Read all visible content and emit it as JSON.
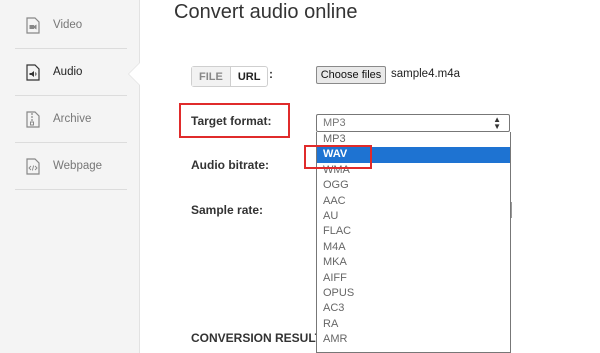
{
  "sidebar": {
    "items": [
      {
        "label": "Video",
        "icon": "video-file-icon"
      },
      {
        "label": "Audio",
        "icon": "audio-file-icon",
        "active": true
      },
      {
        "label": "Archive",
        "icon": "archive-file-icon"
      },
      {
        "label": "Webpage",
        "icon": "code-file-icon"
      }
    ]
  },
  "main": {
    "title": "Convert audio online",
    "source_toggle": {
      "file_label": "FILE",
      "url_label": "URL",
      "separator": ":"
    },
    "choose_files_label": "Choose files",
    "selected_file": "sample4.m4a",
    "target_format_label": "Target format:",
    "audio_bitrate_label": "Audio bitrate:",
    "sample_rate_label": "Sample rate:",
    "conversion_results_label": "CONVERSION RESULTS:",
    "format_select": {
      "value": "MP3",
      "options": [
        "MP3",
        "WAV",
        "WMA",
        "OGG",
        "AAC",
        "AU",
        "FLAC",
        "M4A",
        "MKA",
        "AIFF",
        "OPUS",
        "AC3",
        "RA",
        "AMR"
      ],
      "highlighted": "WAV"
    }
  },
  "colors": {
    "accent": "#1e73d2",
    "annotation": "#e02b2b",
    "sidebar_bg": "#f4f4f4"
  }
}
